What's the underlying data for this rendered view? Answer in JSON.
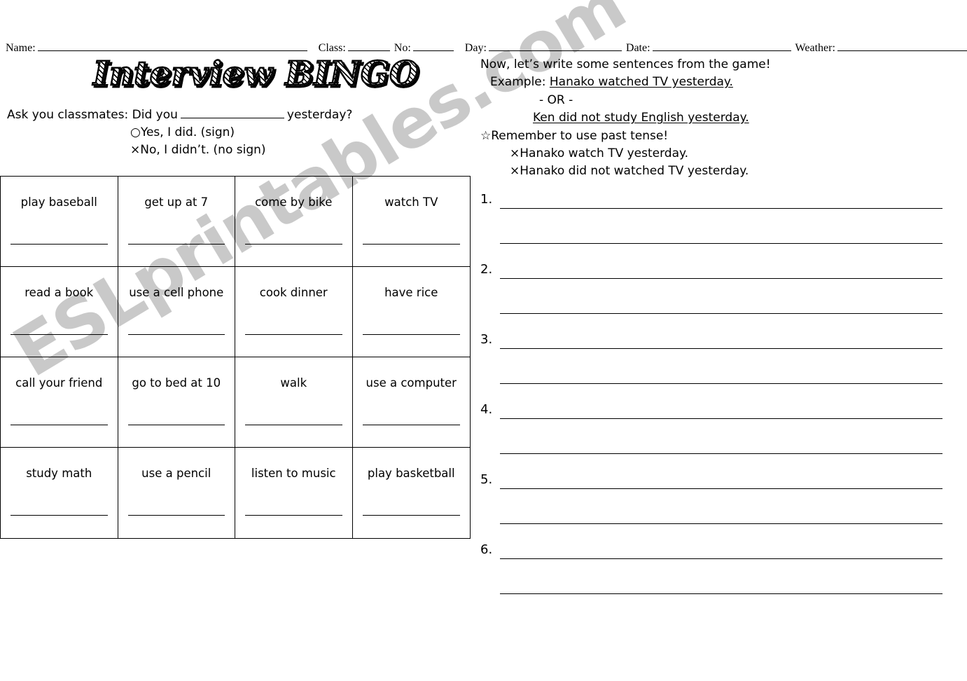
{
  "header": {
    "fields": [
      {
        "label": "Name:",
        "value": "",
        "blank_width": 385
      },
      {
        "label": "Class:",
        "value": "",
        "blank_width": 60
      },
      {
        "label": "No:",
        "value": "",
        "blank_width": 58
      },
      {
        "label": "Day:",
        "value": "",
        "blank_width": 190
      },
      {
        "label": "Date:",
        "value": "",
        "blank_width": 198
      },
      {
        "label": "Weather:",
        "value": "",
        "blank_width": 193
      }
    ]
  },
  "title": "Interview  BINGO",
  "left_instructions": {
    "ask_prefix": "Ask you classmates: Did you",
    "ask_suffix": "yesterday?",
    "yes_symbol": "○",
    "yes_text": "Yes, I did. (sign)",
    "no_symbol": "×",
    "no_text": "No, I didn’t. (no sign)"
  },
  "bingo_grid": {
    "rows": 4,
    "columns": 4,
    "cells": [
      "play baseball",
      "get up at 7",
      "come by bike",
      "watch TV",
      "read a book",
      "use a cell phone",
      "cook dinner",
      "have rice",
      "call your friend",
      "go to bed at 10",
      "walk",
      "use a computer",
      "study math",
      "use a pencil",
      "listen to music",
      "play basketball"
    ]
  },
  "right_instructions": {
    "intro": "Now, let’s write some sentences from the game!",
    "example_label": "Example:",
    "example_sentence": "Hanako watched TV yesterday.",
    "or_text": "- OR -",
    "example_sentence2": "Ken did not study English yesterday.",
    "reminder_symbol": "☆",
    "reminder_text": "Remember to use past tense!",
    "wrong_symbol": "×",
    "wrong1": "Hanako watch TV yesterday.",
    "wrong2": "Hanako did not watched TV yesterday."
  },
  "answers": {
    "items": [
      "1.",
      "2.",
      "3.",
      "4.",
      "5.",
      "6."
    ],
    "lines_per_item": 2
  },
  "watermark": {
    "text": "ESLprintables.com",
    "color": "#c9c9c9"
  }
}
